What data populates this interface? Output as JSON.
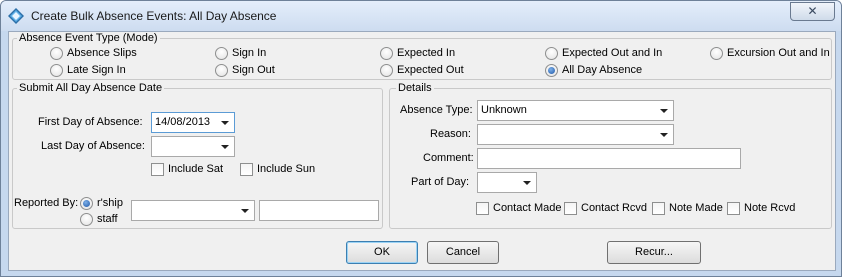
{
  "window": {
    "title": "Create Bulk Absence Events: All Day Absence",
    "close_glyph": "✕",
    "icon": "diamond-app-icon"
  },
  "mode": {
    "legend": "Absence Event Type (Mode)",
    "options": [
      {
        "label": "Absence Slips",
        "checked": false
      },
      {
        "label": "Sign In",
        "checked": false
      },
      {
        "label": "Expected In",
        "checked": false
      },
      {
        "label": "Expected Out and In",
        "checked": false
      },
      {
        "label": "Excursion Out and In",
        "checked": false
      },
      {
        "label": "Late Sign In",
        "checked": false
      },
      {
        "label": "Sign Out",
        "checked": false
      },
      {
        "label": "Expected Out",
        "checked": false
      },
      {
        "label": "All Day Absence",
        "checked": true
      }
    ]
  },
  "submit": {
    "legend": "Submit All Day Absence Date",
    "first_day_label": "First Day of Absence:",
    "first_day_value": "14/08/2013",
    "last_day_label": "Last Day of Absence:",
    "last_day_value": "",
    "include_sat": "Include Sat",
    "include_sun": "Include Sun",
    "reported_by_label": "Reported By:",
    "reported_by_options": [
      {
        "label": "r'ship",
        "checked": true
      },
      {
        "label": "staff",
        "checked": false
      }
    ],
    "reporter_value": "",
    "reporter_text": ""
  },
  "details": {
    "legend": "Details",
    "absence_type_label": "Absence Type:",
    "absence_type_value": "Unknown",
    "reason_label": "Reason:",
    "reason_value": "",
    "comment_label": "Comment:",
    "comment_value": "",
    "part_of_day_label": "Part of Day:",
    "part_of_day_value": "",
    "checks": [
      "Contact Made",
      "Contact Rcvd",
      "Note Made",
      "Note Rcvd"
    ]
  },
  "buttons": {
    "ok": "OK",
    "cancel": "Cancel",
    "recur": "Recur..."
  },
  "colors": {
    "accent": "#1f57a8",
    "focus_border": "#5b9bd5"
  }
}
